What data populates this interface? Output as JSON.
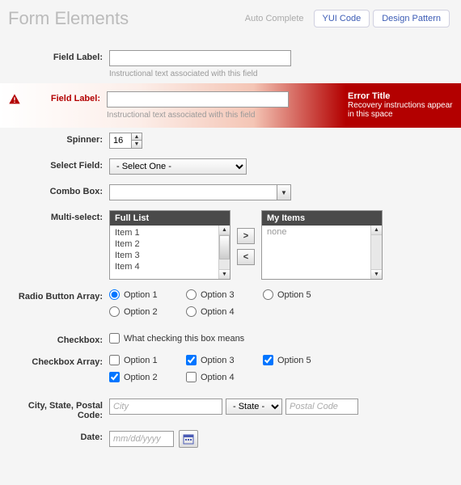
{
  "header": {
    "title": "Form Elements",
    "auto_complete": "Auto Complete",
    "yui_code": "YUI Code",
    "design_pattern": "Design Pattern"
  },
  "field1": {
    "label": "Field Label:",
    "hint": "Instructional text associated with this field"
  },
  "field_error": {
    "label": "Field Label:",
    "hint": "Instructional text associated with this field",
    "error_title": "Error Title",
    "error_msg": "Recovery instructions appear in this space"
  },
  "spinner": {
    "label": "Spinner:",
    "value": "16"
  },
  "select": {
    "label": "Select Field:",
    "placeholder": "- Select One -"
  },
  "combo": {
    "label": "Combo Box:"
  },
  "multi": {
    "label": "Multi-select:",
    "full_header": "Full List",
    "my_header": "My Items",
    "items": {
      "i1": "Item 1",
      "i2": "Item 2",
      "i3": "Item 3",
      "i4": "Item 4"
    },
    "none": "none",
    "move_right": ">",
    "move_left": "<"
  },
  "radios": {
    "label": "Radio Button Array:",
    "o1": "Option 1",
    "o2": "Option 2",
    "o3": "Option 3",
    "o4": "Option 4",
    "o5": "Option 5"
  },
  "checkbox": {
    "label": "Checkbox:",
    "text": "What checking this box means"
  },
  "check_array": {
    "label": "Checkbox Array:",
    "o1": "Option 1",
    "o2": "Option 2",
    "o3": "Option 3",
    "o4": "Option 4",
    "o5": "Option 5"
  },
  "csz": {
    "label": "City, State, Postal Code:",
    "city_ph": "City",
    "state_ph": "- State -",
    "postal_ph": "Postal Code"
  },
  "date": {
    "label": "Date:",
    "placeholder": "mm/dd/yyyy"
  }
}
